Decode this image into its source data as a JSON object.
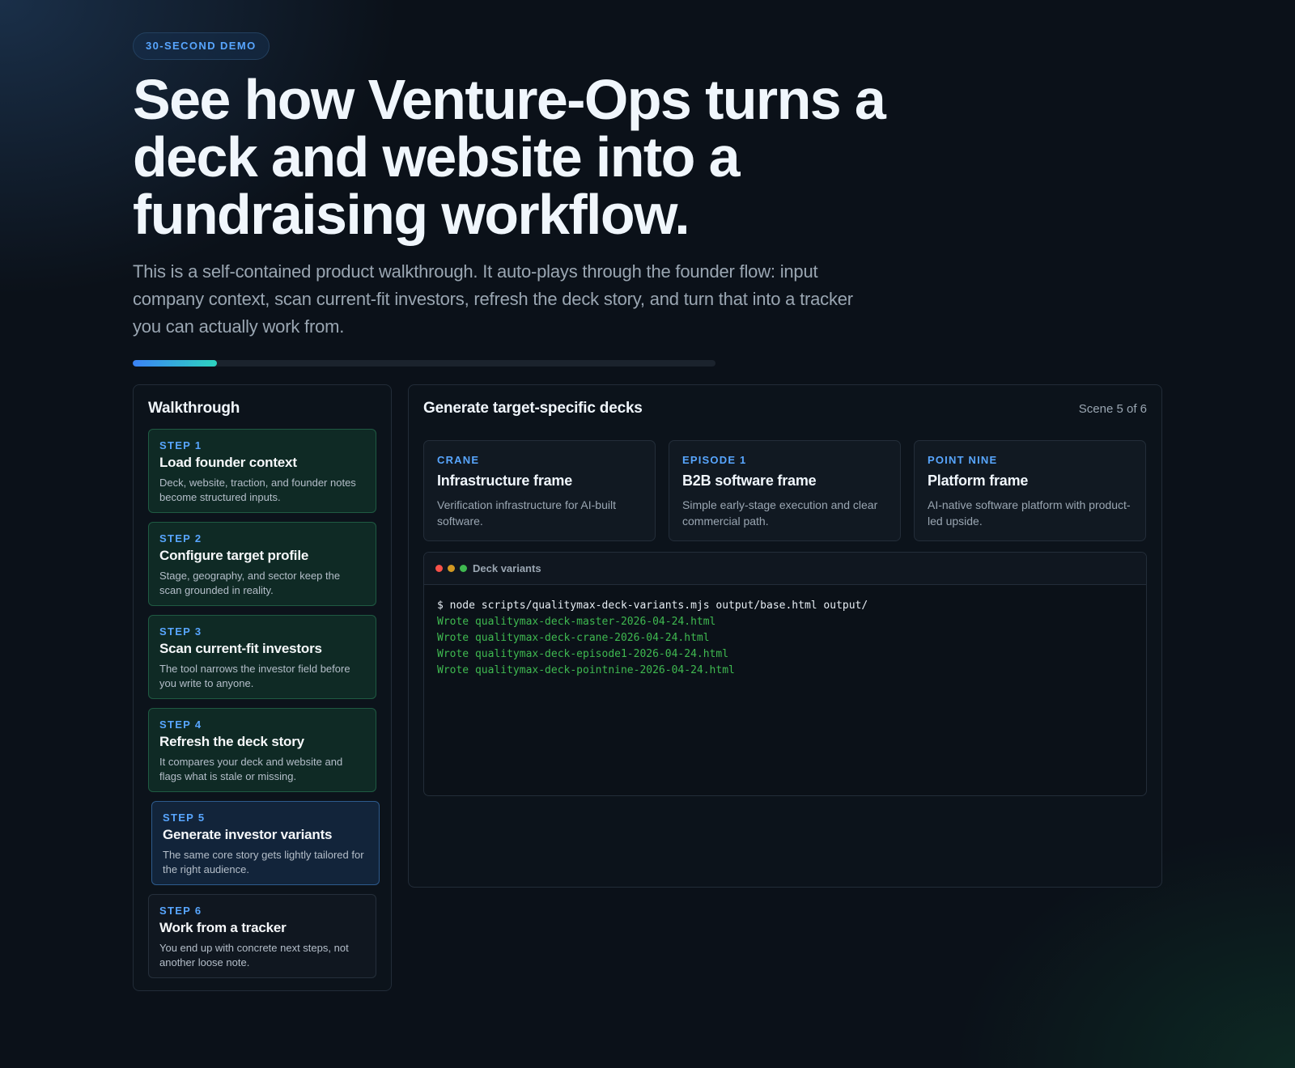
{
  "hero": {
    "badge": "30-SECOND DEMO",
    "headline": "See how Venture-Ops turns a deck and website into a fundraising workflow.",
    "lead": "This is a self-contained product walkthrough. It auto-plays through the founder flow: input company context, scan current-fit investors, refresh the deck story, and turn that into a tracker you can actually work from.",
    "progress_fraction": 0.145
  },
  "sidebar": {
    "title": "Walkthrough",
    "steps": [
      {
        "num": "STEP 1",
        "title": "Load founder context",
        "desc": "Deck, website, traction, and founder notes become structured inputs.",
        "state": "done"
      },
      {
        "num": "STEP 2",
        "title": "Configure target profile",
        "desc": "Stage, geography, and sector keep the scan grounded in reality.",
        "state": "done"
      },
      {
        "num": "STEP 3",
        "title": "Scan current-fit investors",
        "desc": "The tool narrows the investor field before you write to anyone.",
        "state": "done"
      },
      {
        "num": "STEP 4",
        "title": "Refresh the deck story",
        "desc": "It compares your deck and website and flags what is stale or missing.",
        "state": "done"
      },
      {
        "num": "STEP 5",
        "title": "Generate investor variants",
        "desc": "The same core story gets lightly tailored for the right audience.",
        "state": "active"
      },
      {
        "num": "STEP 6",
        "title": "Work from a tracker",
        "desc": "You end up with concrete next steps, not another loose note.",
        "state": "upcoming"
      }
    ]
  },
  "main": {
    "title": "Generate target-specific decks",
    "scene": "Scene 5 of 6",
    "cards": [
      {
        "tag": "CRANE",
        "title": "Infrastructure frame",
        "desc": "Verification infrastructure for AI-built software."
      },
      {
        "tag": "EPISODE 1",
        "title": "B2B software frame",
        "desc": "Simple early-stage execution and clear commercial path."
      },
      {
        "tag": "POINT NINE",
        "title": "Platform frame",
        "desc": "AI-native software platform with product-led upside."
      }
    ],
    "terminal": {
      "title": "Deck variants",
      "command": "$ node scripts/qualitymax-deck-variants.mjs output/base.html output/",
      "output": [
        "Wrote qualitymax-deck-master-2026-04-24.html",
        "Wrote qualitymax-deck-crane-2026-04-24.html",
        "Wrote qualitymax-deck-episode1-2026-04-24.html",
        "Wrote qualitymax-deck-pointnine-2026-04-24.html"
      ]
    }
  },
  "colors": {
    "accent": "#58a6ff",
    "terminal_output": "#3fb950",
    "progress_start": "#3b82f6",
    "progress_end": "#2dd4bf"
  }
}
